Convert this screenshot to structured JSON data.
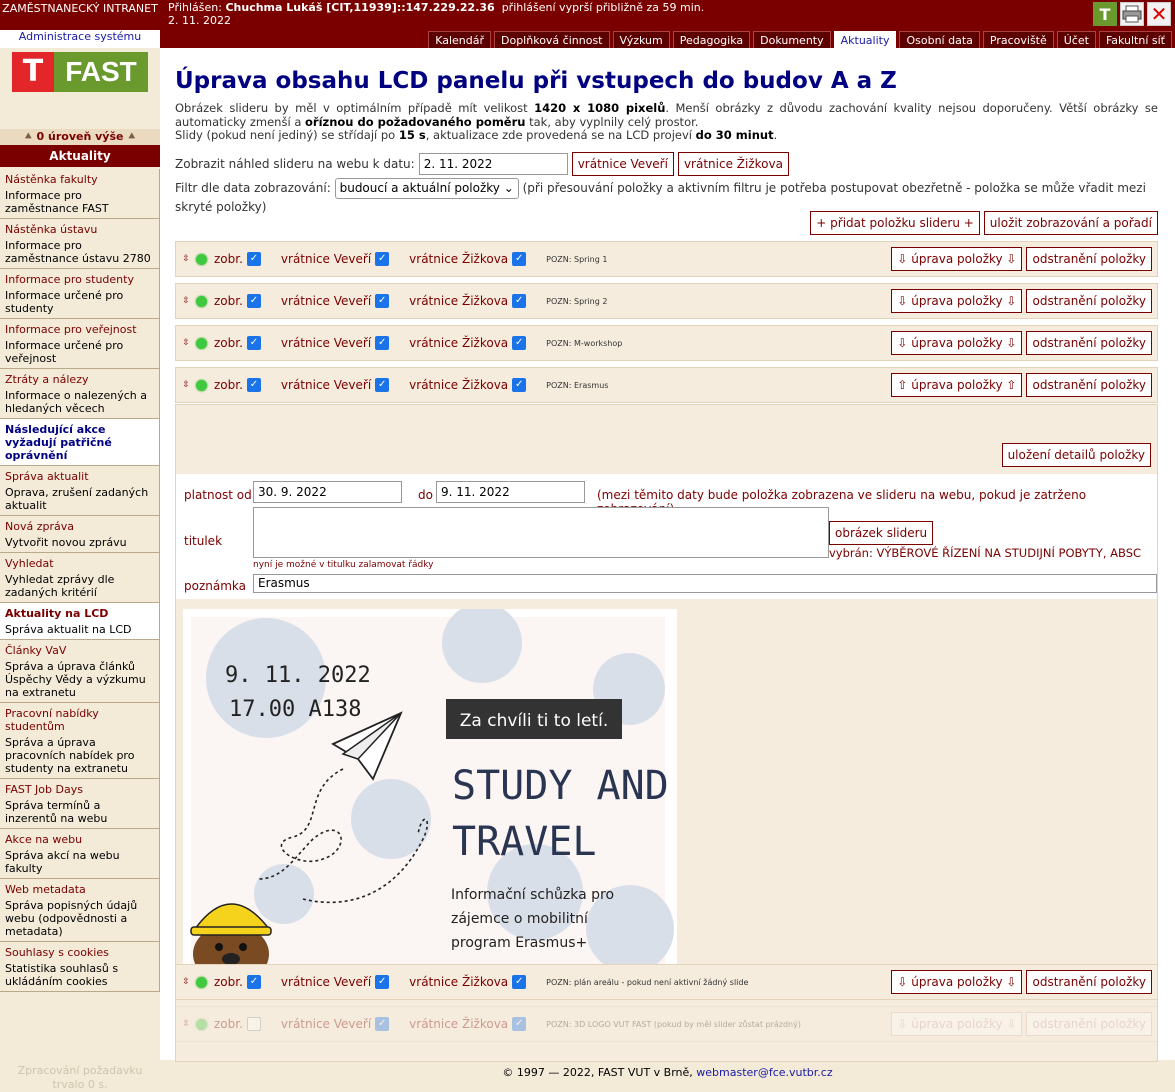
{
  "header": {
    "employee_label": "ZAMĚSTNANECKÝ INTRANET",
    "admin_link": "Administrace systému",
    "login_prefix": "Přihlášen:",
    "user": "Chuchma Lukáš [CIT,11939]::147.229.22.36",
    "session_text": "přihlášení vyprší přibližně za 59 min.",
    "date": "2. 11. 2022",
    "icons": [
      "teams-icon",
      "printer-icon",
      "close-icon"
    ]
  },
  "tabs": [
    {
      "label": "Kalendář",
      "active": false
    },
    {
      "label": "Doplňková činnost",
      "active": false
    },
    {
      "label": "Výzkum",
      "active": false
    },
    {
      "label": "Pedagogika",
      "active": false
    },
    {
      "label": "Dokumenty",
      "active": false
    },
    {
      "label": "Aktuality",
      "active": true
    },
    {
      "label": "Osobní data",
      "active": false
    },
    {
      "label": "Pracoviště",
      "active": false
    },
    {
      "label": "Účet",
      "active": false
    },
    {
      "label": "Fakultní síť",
      "active": false
    }
  ],
  "sidebar": {
    "logo_text": "FAST",
    "uplevel": "0 úroveň výše",
    "heading": "Aktuality",
    "items": [
      {
        "title": "Nástěnka fakulty",
        "desc": "Informace pro zaměstnance FAST"
      },
      {
        "title": "Nástěnka ústavu",
        "desc": "Informace pro zaměstnance ústavu 2780"
      },
      {
        "title": "Informace pro studenty",
        "desc": "Informace určené pro studenty"
      },
      {
        "title": "Informace pro veřejnost",
        "desc": "Informace určené pro veřejnost"
      },
      {
        "title": "Ztráty a nálezy",
        "desc": "Informace o nalezených a hledaných věcech"
      }
    ],
    "section_title": "Následující akce vyžadují patřičné oprávnění",
    "items2": [
      {
        "title": "Správa aktualit",
        "desc": "Oprava, zrušení zadaných aktualit"
      },
      {
        "title": "Nová zpráva",
        "desc": "Vytvořit novou zprávu"
      },
      {
        "title": "Vyhledat",
        "desc": "Vyhledat zprávy dle zadaných kritérií"
      },
      {
        "title": "Aktuality na LCD",
        "desc": "Správa aktualit na LCD",
        "active": true
      },
      {
        "title": "Články VaV",
        "desc": "Správa a úprava článků Úspěchy Vědy a výzkumu na extranetu"
      },
      {
        "title": "Pracovní nabídky studentům",
        "desc": "Správa a úprava pracovních nabídek pro studenty na extranetu"
      },
      {
        "title": "FAST Job Days",
        "desc": "Správa termínů a inzerentů na webu"
      },
      {
        "title": "Akce na webu",
        "desc": "Správa akcí na webu fakulty"
      },
      {
        "title": "Web metadata",
        "desc": "Správa popisných údajů webu (odpovědnosti a metadata)"
      },
      {
        "title": "Souhlasy s cookies",
        "desc": "Statistika souhlasů s ukládáním cookies"
      }
    ],
    "footer": "Zpracování požadavku trvalo 0 s."
  },
  "main": {
    "title": "Úprava obsahu LCD panelu při vstupech do budov A a Z",
    "intro_1a": "Obrázek slideru by měl v optimálním případě mít velikost ",
    "intro_1b": "1420 x 1080 pixelů",
    "intro_1c": ". Menší obrázky z důvodu zachování kvality nejsou doporučeny. Větší obrázky se automaticky zmenší a ",
    "intro_1d": "oříznou do požadovaného poměru",
    "intro_1e": " tak, aby vyplnily celý prostor.",
    "intro_2a": "Slidy (pokud není jediný) se střídají po ",
    "intro_2b": "15 s",
    "intro_2c": ", aktualizace zde provedená se na LCD projeví ",
    "intro_2d": "do 30 minut",
    "intro_2e": ".",
    "preview_label": "Zobrazit náhled slideru na webu k datu:",
    "preview_date": "2. 11. 2022",
    "btn_vevery": "vrátnice Veveří",
    "btn_zizkova": "vrátnice Žižkova",
    "filter_label": "Filtr dle data zobrazování:",
    "filter_value": "budoucí a aktuální položky",
    "filter_note": "(při přesouvání položky a aktivním filtru je potřeba postupovat obezřetně - položka se může vřadit mezi skryté položky)",
    "add_btn": "+ přidat položku slideru +",
    "save_btn": "uložit zobrazování a pořadí"
  },
  "row_labels": {
    "show": "zobr.",
    "vevery": "vrátnice Veveří",
    "zizkova": "vrátnice Žižkova",
    "note_prefix": "POZN:",
    "edit_down": "⇩ úprava položky ⇩",
    "edit_up": "⇧ úprava položky ⇧",
    "delete": "odstranění položky"
  },
  "rows": [
    {
      "note": "Spring 1",
      "active": true
    },
    {
      "note": "Spring 2",
      "active": true
    },
    {
      "note": "M-workshop",
      "active": true
    },
    {
      "note": "Erasmus",
      "active": true,
      "expanded": true
    },
    {
      "note": "plán areálu - pokud není aktivní žádný slide",
      "active": true
    },
    {
      "note": "3D LOGO VUT FAST (pokud by měl slider zůstat prázdný)",
      "active": false
    }
  ],
  "detail": {
    "save_detail": "uložení detailů položky",
    "valid_from_label": "platnost od",
    "valid_from": "30. 9. 2022",
    "valid_to_label": "do",
    "valid_to": "9. 11. 2022",
    "valid_note": "(mezi těmito daty bude položka zobrazena ve slideru na webu, pokud je zatrženo zobrazování)",
    "title_label": "titulek",
    "title_value": "",
    "title_hint": "nyní je možné v titulku zalamovat řádky",
    "image_btn": "obrázek slideru",
    "image_selected": "vybrán: VÝBĚROVÉ ŘÍZENÍ NA STUDIJNÍ POBYTY, ABSC",
    "note_label": "poznámka",
    "note_value": "Erasmus"
  },
  "poster": {
    "date": "9. 11. 2022",
    "time": "17.00 A138",
    "banner": "Za chvíli ti to letí.",
    "headline_1": "STUDY AND",
    "headline_2": "TRAVEL",
    "sub_1": "Informační schůzka pro",
    "sub_2": "zájemce o mobilitní",
    "sub_3": "program Erasmus+"
  },
  "footer": {
    "copyright": "© 1997 — 2022, FAST VUT v Brně,",
    "email": "webmaster@fce.vutbr.cz"
  }
}
